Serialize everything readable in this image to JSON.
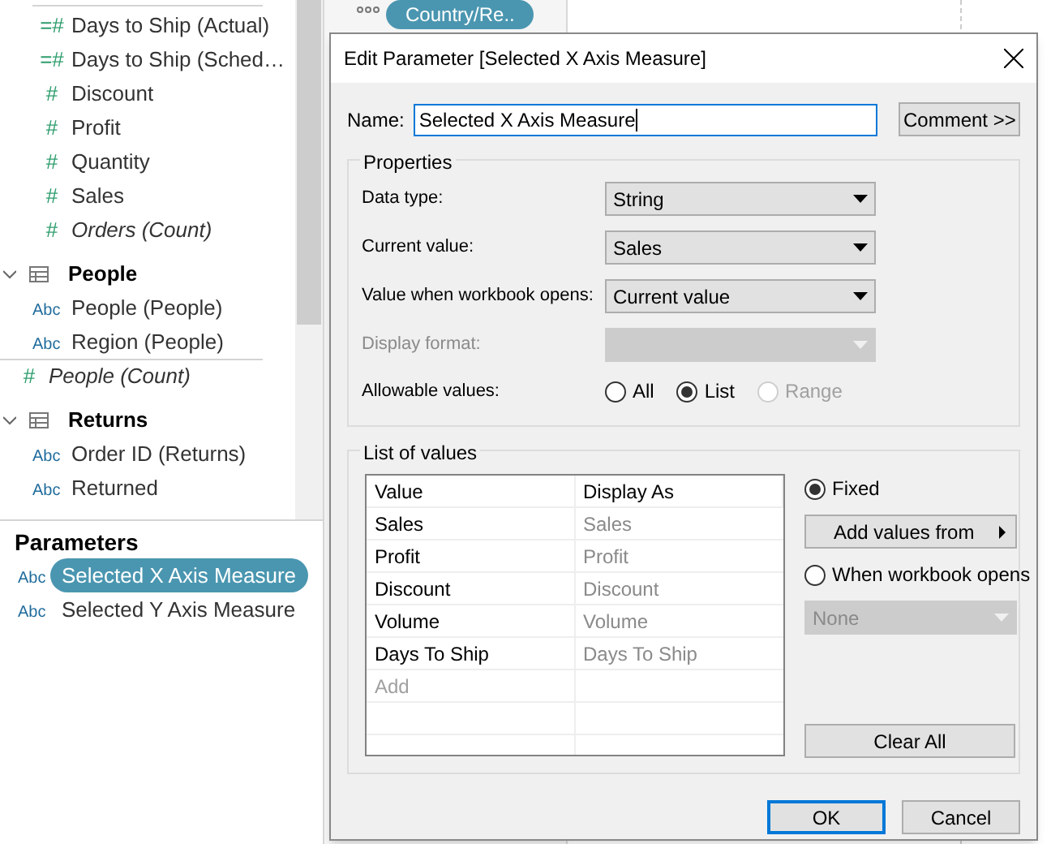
{
  "sidebar": {
    "fields": [
      {
        "kind": "measure",
        "glyph": "=#",
        "label": "Days to Ship (Actual)",
        "italic": false
      },
      {
        "kind": "measure",
        "glyph": "=#",
        "label": "Days to Ship (Sched…",
        "italic": false
      },
      {
        "kind": "measure",
        "glyph": "#",
        "label": "Discount",
        "italic": false
      },
      {
        "kind": "measure",
        "glyph": "#",
        "label": "Profit",
        "italic": false
      },
      {
        "kind": "measure",
        "glyph": "#",
        "label": "Quantity",
        "italic": false
      },
      {
        "kind": "measure",
        "glyph": "#",
        "label": "Sales",
        "italic": false
      },
      {
        "kind": "measure",
        "glyph": "#",
        "label": "Orders (Count)",
        "italic": true
      }
    ],
    "tables": [
      {
        "name": "People",
        "expanded": true,
        "fields": [
          {
            "kind": "dimension",
            "glyph": "Abc",
            "label": "People (People)",
            "italic": false
          },
          {
            "kind": "dimension",
            "glyph": "Abc",
            "label": "Region (People)",
            "italic": false
          },
          {
            "kind": "measure",
            "glyph": "#",
            "label": "People (Count)",
            "italic": true
          }
        ]
      },
      {
        "name": "Returns",
        "expanded": true,
        "fields": [
          {
            "kind": "dimension",
            "glyph": "Abc",
            "label": "Order ID (Returns)",
            "italic": false
          },
          {
            "kind": "dimension",
            "glyph": "Abc",
            "label": "Returned",
            "italic": false
          }
        ]
      }
    ]
  },
  "parameters": {
    "title": "Parameters",
    "items": [
      {
        "kind": "dimension",
        "glyph": "Abc",
        "label": "Selected X Axis Measure",
        "selected": true
      },
      {
        "kind": "dimension",
        "glyph": "Abc",
        "label": "Selected Y Axis Measure",
        "selected": false
      }
    ]
  },
  "shelf": {
    "pill": "Country/Re.."
  },
  "dialog": {
    "title": "Edit Parameter [Selected X Axis Measure]",
    "name_label": "Name:",
    "name_value": "Selected X Axis Measure",
    "comment_button": "Comment >>",
    "properties": {
      "title": "Properties",
      "rows": [
        {
          "label": "Data type:",
          "value": "String",
          "disabled": false
        },
        {
          "label": "Current value:",
          "value": "Sales",
          "disabled": false
        },
        {
          "label": "Value when workbook opens:",
          "value": "Current value",
          "disabled": false
        },
        {
          "label": "Display format:",
          "disabled": true
        }
      ],
      "allowable_label": "Allowable values:",
      "allowable": [
        {
          "label": "All",
          "selected": false,
          "disabled": false
        },
        {
          "label": "List",
          "selected": true,
          "disabled": false
        },
        {
          "label": "Range",
          "selected": false,
          "disabled": true
        }
      ]
    },
    "list": {
      "title": "List of values",
      "columns": [
        "Value",
        "Display As"
      ],
      "rows": [
        {
          "value": "Sales",
          "display": "Sales"
        },
        {
          "value": "Profit",
          "display": "Profit"
        },
        {
          "value": "Discount",
          "display": "Discount"
        },
        {
          "value": "Volume",
          "display": "Volume"
        },
        {
          "value": "Days To Ship",
          "display": "Days To Ship"
        }
      ],
      "add_placeholder": "Add",
      "sources": [
        {
          "label": "Fixed",
          "selected": true
        },
        {
          "label": "When workbook opens",
          "selected": false
        }
      ],
      "add_values_button": "Add values from",
      "when_opens_select": {
        "value": "None",
        "disabled": true
      },
      "clear_button": "Clear All"
    },
    "buttons": [
      {
        "label": "OK",
        "default": true
      },
      {
        "label": "Cancel",
        "default": false
      }
    ]
  }
}
